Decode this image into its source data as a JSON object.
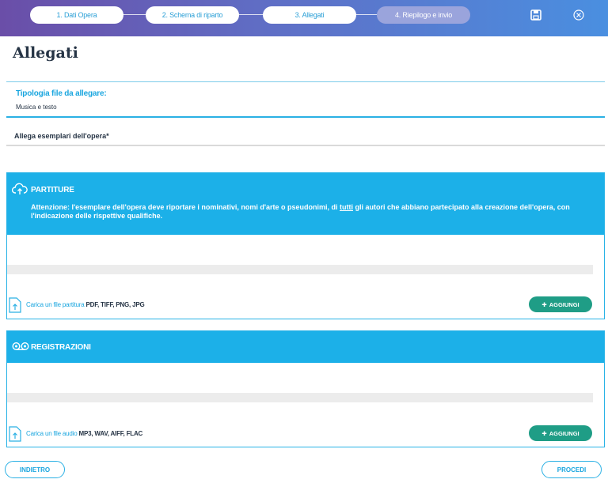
{
  "stepper": {
    "steps": [
      {
        "label": "1. Dati Opera"
      },
      {
        "label": "2. Schema di riparto"
      },
      {
        "label": "3. Allegati"
      },
      {
        "label": "4. Riepilogo e invio"
      }
    ],
    "active_step": 3
  },
  "toolbar": {
    "save_icon": "save-icon",
    "close_icon": "close-circle-icon"
  },
  "page": {
    "title": "Allegati"
  },
  "file_type": {
    "label": "Tipologia file da allegare:",
    "value": "Musica e testo"
  },
  "attach": {
    "heading": "Allega esemplari dell'opera*"
  },
  "partiture": {
    "title": "PARTITURE",
    "icon": "cloud-upload-icon",
    "warning_before": "Attenzione: l'esemplare dell'opera deve riportare i nominativi, nomi d'arte o pseudonimi, di ",
    "warning_emph": "tutti",
    "warning_after": " gli autori che abbiano partecipato alla creazione dell'opera, con l'indicazione delle rispettive qualifiche.",
    "upload_label": "Carica un file partitura",
    "upload_ext": "PDF, TIFF, PNG, JPG",
    "add_label": "AGGIUNGI"
  },
  "registrazioni": {
    "title": "REGISTRAZIONI",
    "icon": "cassette-icon",
    "upload_label": "Carica un file audio",
    "upload_ext": "MP3, WAV, AIFF, FLAC",
    "add_label": "AGGIUNGI"
  },
  "navigation": {
    "back_label": "INDIETRO",
    "next_label": "PROCEDI"
  },
  "colors": {
    "accent": "#1cb0e8",
    "add_button": "#1f9d86",
    "header_start": "#6a4ea8",
    "header_end": "#4a8fe0"
  }
}
